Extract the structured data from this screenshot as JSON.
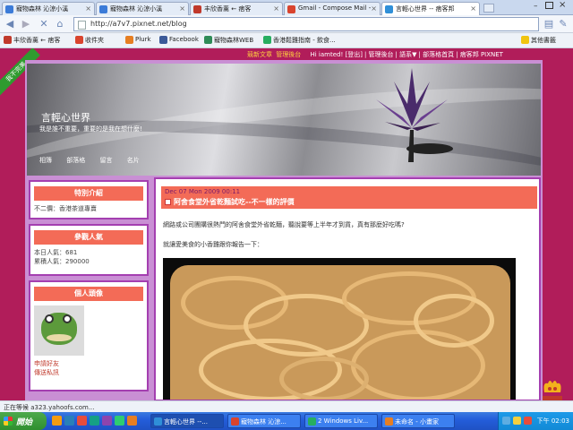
{
  "browser": {
    "tabs": [
      {
        "label": "寵物森林 沁涼小溪",
        "color": "#3b7bd8",
        "active": false
      },
      {
        "label": "寵物森林 沁涼小溪",
        "color": "#3b7bd8",
        "active": false
      },
      {
        "label": "丰欣香薰 ← 痞客",
        "color": "#c0392b",
        "active": false
      },
      {
        "label": "Gmail - Compose Mail -",
        "color": "#d9442e",
        "active": false
      },
      {
        "label": "言輕心世界 -- 痞客邦",
        "color": "#2f8fd8",
        "active": true
      }
    ],
    "address": "http://a7v7.pixnet.net/blog",
    "bookmarks": [
      {
        "label": "丰欣香薰 ← 痞客",
        "color": "#c0392b"
      },
      {
        "label": "收件夾",
        "color": "#d9442e"
      },
      {
        "label": "Plurk",
        "color": "#e67e22"
      },
      {
        "label": "Facebook",
        "color": "#3b5998"
      },
      {
        "label": "寵物森林WEB",
        "color": "#2e8b57"
      },
      {
        "label": "香港鬆雞指南 - 飲食...",
        "color": "#27ae60"
      },
      {
        "label": "其他書籤",
        "color": "#f1c40f"
      }
    ],
    "status_text": "正在等候 a323.yahoofs.com..."
  },
  "site": {
    "ribbon": "我不完美",
    "toplinks": {
      "highlight": [
        "競新文章",
        "管理後台"
      ],
      "items": [
        "Hi iamted! [登出]",
        "管理後台",
        "語系▼",
        "部落格首頁",
        "痞客邦 PIXNET"
      ]
    },
    "title": "言輕心世界",
    "subtitle": "我是誰不重要，重要的是我在想什麼!",
    "menu": [
      "相簿",
      "部落格",
      "留言",
      "名片"
    ]
  },
  "sidebar": {
    "intro": {
      "title": "特別介紹",
      "text": "不二價：香港茶道專賣"
    },
    "visitors": {
      "title": "參觀人氣",
      "today_label": "本日人氣：",
      "today": "681",
      "total_label": "累積人氣：",
      "total": "290000"
    },
    "profile": {
      "title": "個人頭像",
      "link1": "申請好友",
      "link2": "傳送私訊"
    }
  },
  "post": {
    "date": "Dec 07 Mon 2009 00:11",
    "title": "阿舍食堂外省乾麵試吃--不一樣的評價",
    "para1": "網路或公司團購很熱門的阿舍食堂外省乾麵，聽說要等上半年才到貨，真有那麼好吃嗎?",
    "para2": "就讓愛美食的小香雞跟你報告一下："
  },
  "taskbar": {
    "start": "開始",
    "tasks": [
      {
        "label": "言輕心世界 --...",
        "color": "#2f8fd8"
      },
      {
        "label": "寵物森林 沁涼...",
        "color": "#d9442e"
      },
      {
        "label": "2 Windows Liv...",
        "color": "#27ae60"
      },
      {
        "label": "未命名 - 小畫家",
        "color": "#e67e22"
      }
    ],
    "clock": "下午 02:03"
  }
}
